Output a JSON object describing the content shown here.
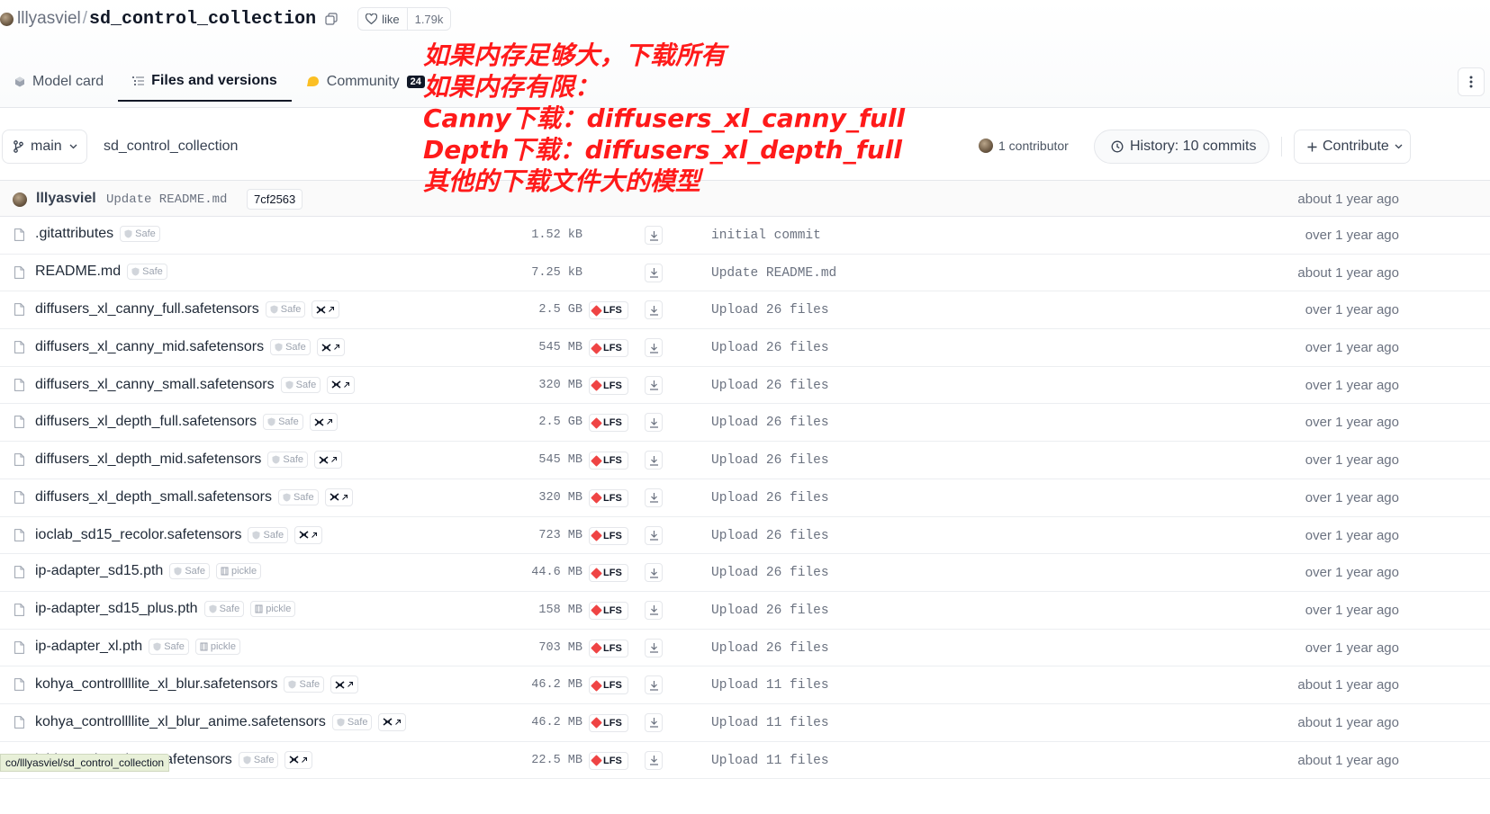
{
  "header": {
    "owner": "lllyasviel",
    "separator": "/",
    "repo": "sd_control_collection",
    "like_label": "like",
    "like_count": "1.79k"
  },
  "tabs": [
    {
      "label": "Model card",
      "icon": "model-card-icon"
    },
    {
      "label": "Files and versions",
      "icon": "files-icon",
      "active": true
    },
    {
      "label": "Community",
      "icon": "community-icon",
      "badge": "24"
    }
  ],
  "toolbar": {
    "branch": "main",
    "path": "sd_control_collection",
    "contributors": "1 contributor",
    "history": "History: 10 commits",
    "contribute": "Contribute"
  },
  "last_commit": {
    "author": "lllyasviel",
    "message": "Update README.md",
    "hash": "7cf2563",
    "date": "about 1 year ago"
  },
  "files": [
    {
      "name": ".gitattributes",
      "safe": "Safe",
      "size": "1.52 kB",
      "lfs": false,
      "xet": false,
      "pickle": "",
      "message": "initial commit",
      "date": "over 1 year ago"
    },
    {
      "name": "README.md",
      "safe": "Safe",
      "size": "7.25 kB",
      "lfs": false,
      "xet": false,
      "pickle": "",
      "message": "Update README.md",
      "date": "about 1 year ago"
    },
    {
      "name": "diffusers_xl_canny_full.safetensors",
      "safe": "Safe",
      "size": "2.5 GB",
      "lfs": true,
      "xet": true,
      "pickle": "",
      "message": "Upload 26 files",
      "date": "over 1 year ago"
    },
    {
      "name": "diffusers_xl_canny_mid.safetensors",
      "safe": "Safe",
      "size": "545 MB",
      "lfs": true,
      "xet": true,
      "pickle": "",
      "message": "Upload 26 files",
      "date": "over 1 year ago"
    },
    {
      "name": "diffusers_xl_canny_small.safetensors",
      "safe": "Safe",
      "size": "320 MB",
      "lfs": true,
      "xet": true,
      "pickle": "",
      "message": "Upload 26 files",
      "date": "over 1 year ago"
    },
    {
      "name": "diffusers_xl_depth_full.safetensors",
      "safe": "Safe",
      "size": "2.5 GB",
      "lfs": true,
      "xet": true,
      "pickle": "",
      "message": "Upload 26 files",
      "date": "over 1 year ago"
    },
    {
      "name": "diffusers_xl_depth_mid.safetensors",
      "safe": "Safe",
      "size": "545 MB",
      "lfs": true,
      "xet": true,
      "pickle": "",
      "message": "Upload 26 files",
      "date": "over 1 year ago"
    },
    {
      "name": "diffusers_xl_depth_small.safetensors",
      "safe": "Safe",
      "size": "320 MB",
      "lfs": true,
      "xet": true,
      "pickle": "",
      "message": "Upload 26 files",
      "date": "over 1 year ago"
    },
    {
      "name": "ioclab_sd15_recolor.safetensors",
      "safe": "Safe",
      "size": "723 MB",
      "lfs": true,
      "xet": true,
      "pickle": "",
      "message": "Upload 26 files",
      "date": "over 1 year ago"
    },
    {
      "name": "ip-adapter_sd15.pth",
      "safe": "Safe",
      "size": "44.6 MB",
      "lfs": true,
      "xet": false,
      "pickle": "pickle",
      "message": "Upload 26 files",
      "date": "over 1 year ago"
    },
    {
      "name": "ip-adapter_sd15_plus.pth",
      "safe": "Safe",
      "size": "158 MB",
      "lfs": true,
      "xet": false,
      "pickle": "pickle",
      "message": "Upload 26 files",
      "date": "over 1 year ago"
    },
    {
      "name": "ip-adapter_xl.pth",
      "safe": "Safe",
      "size": "703 MB",
      "lfs": true,
      "xet": false,
      "pickle": "pickle",
      "message": "Upload 26 files",
      "date": "over 1 year ago"
    },
    {
      "name": "kohya_controllllite_xl_blur.safetensors",
      "safe": "Safe",
      "size": "46.2 MB",
      "lfs": true,
      "xet": true,
      "pickle": "",
      "message": "Upload 11 files",
      "date": "about 1 year ago"
    },
    {
      "name": "kohya_controllllite_xl_blur_anime.safetensors",
      "safe": "Safe",
      "size": "46.2 MB",
      "lfs": true,
      "xet": true,
      "pickle": "",
      "message": "Upload 11 files",
      "date": "about 1 year ago"
    },
    {
      "name": "l_blur_anime_beta.safetensors",
      "safe": "Safe",
      "size": "22.5 MB",
      "lfs": true,
      "xet": true,
      "pickle": "",
      "message": "Upload 11 files",
      "date": "about 1 year ago",
      "partial": true
    }
  ],
  "lfs_label": "LFS",
  "status_url": "co/lllyasviel/sd_control_collection",
  "annotation": [
    "如果内存足够大，下载所有",
    "如果内存有限：",
    "Canny下载：diffusers_xl_canny_full",
    "Depth下载：diffusers_xl_depth_full",
    "其他的下载文件大的模型"
  ],
  "colors": {
    "annotation": "#ff1a1a",
    "lfs_icon": "#ef4444",
    "community_icon": "#fbbf24",
    "status_bg": "#e8f0d8"
  }
}
